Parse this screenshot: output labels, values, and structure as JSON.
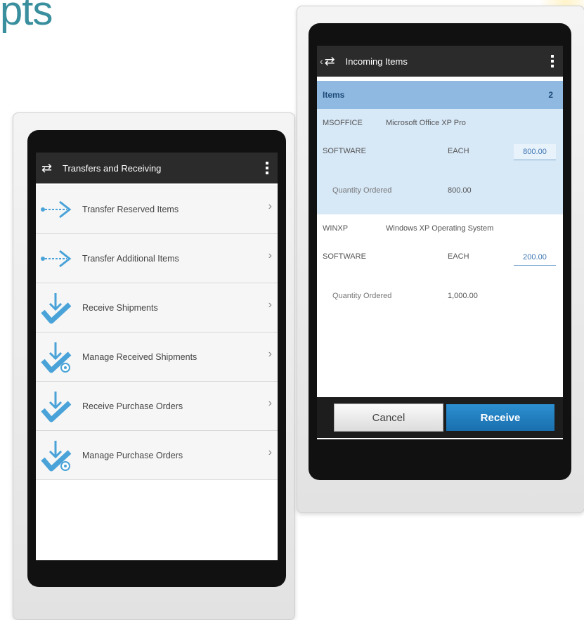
{
  "heading": "pts",
  "left_phone": {
    "title": "Transfers and Receiving",
    "items": [
      {
        "label": "Transfer Reserved Items",
        "icon": "arrow-right-icon"
      },
      {
        "label": "Transfer Additional Items",
        "icon": "arrow-right-icon"
      },
      {
        "label": "Receive Shipments",
        "icon": "receive-check-icon"
      },
      {
        "label": "Manage Received Shipments",
        "icon": "receive-check-gear-icon"
      },
      {
        "label": "Receive Purchase Orders",
        "icon": "receive-check-icon"
      },
      {
        "label": "Manage Purchase Orders",
        "icon": "receive-check-gear-icon"
      }
    ]
  },
  "right_phone": {
    "title": "Incoming Items",
    "items_header": {
      "label": "Items",
      "count": "2"
    },
    "entries": [
      {
        "code": "MSOFFICE",
        "description": "Microsoft Office XP Pro",
        "category": "SOFTWARE",
        "uom": "EACH",
        "qty": "800.00",
        "ordered_label": "Quantity Ordered",
        "ordered": "800.00"
      },
      {
        "code": "WINXP",
        "description": "Windows XP Operating System",
        "category": "SOFTWARE",
        "uom": "EACH",
        "qty": "200.00",
        "ordered_label": "Quantity Ordered",
        "ordered": "1,000.00"
      }
    ],
    "cancel_label": "Cancel",
    "receive_label": "Receive"
  },
  "colors": {
    "accent": "#2c8fd0",
    "heading": "#3a8f9e",
    "selected_row": "#d7e8f7",
    "items_header": "#8fb9e0"
  }
}
